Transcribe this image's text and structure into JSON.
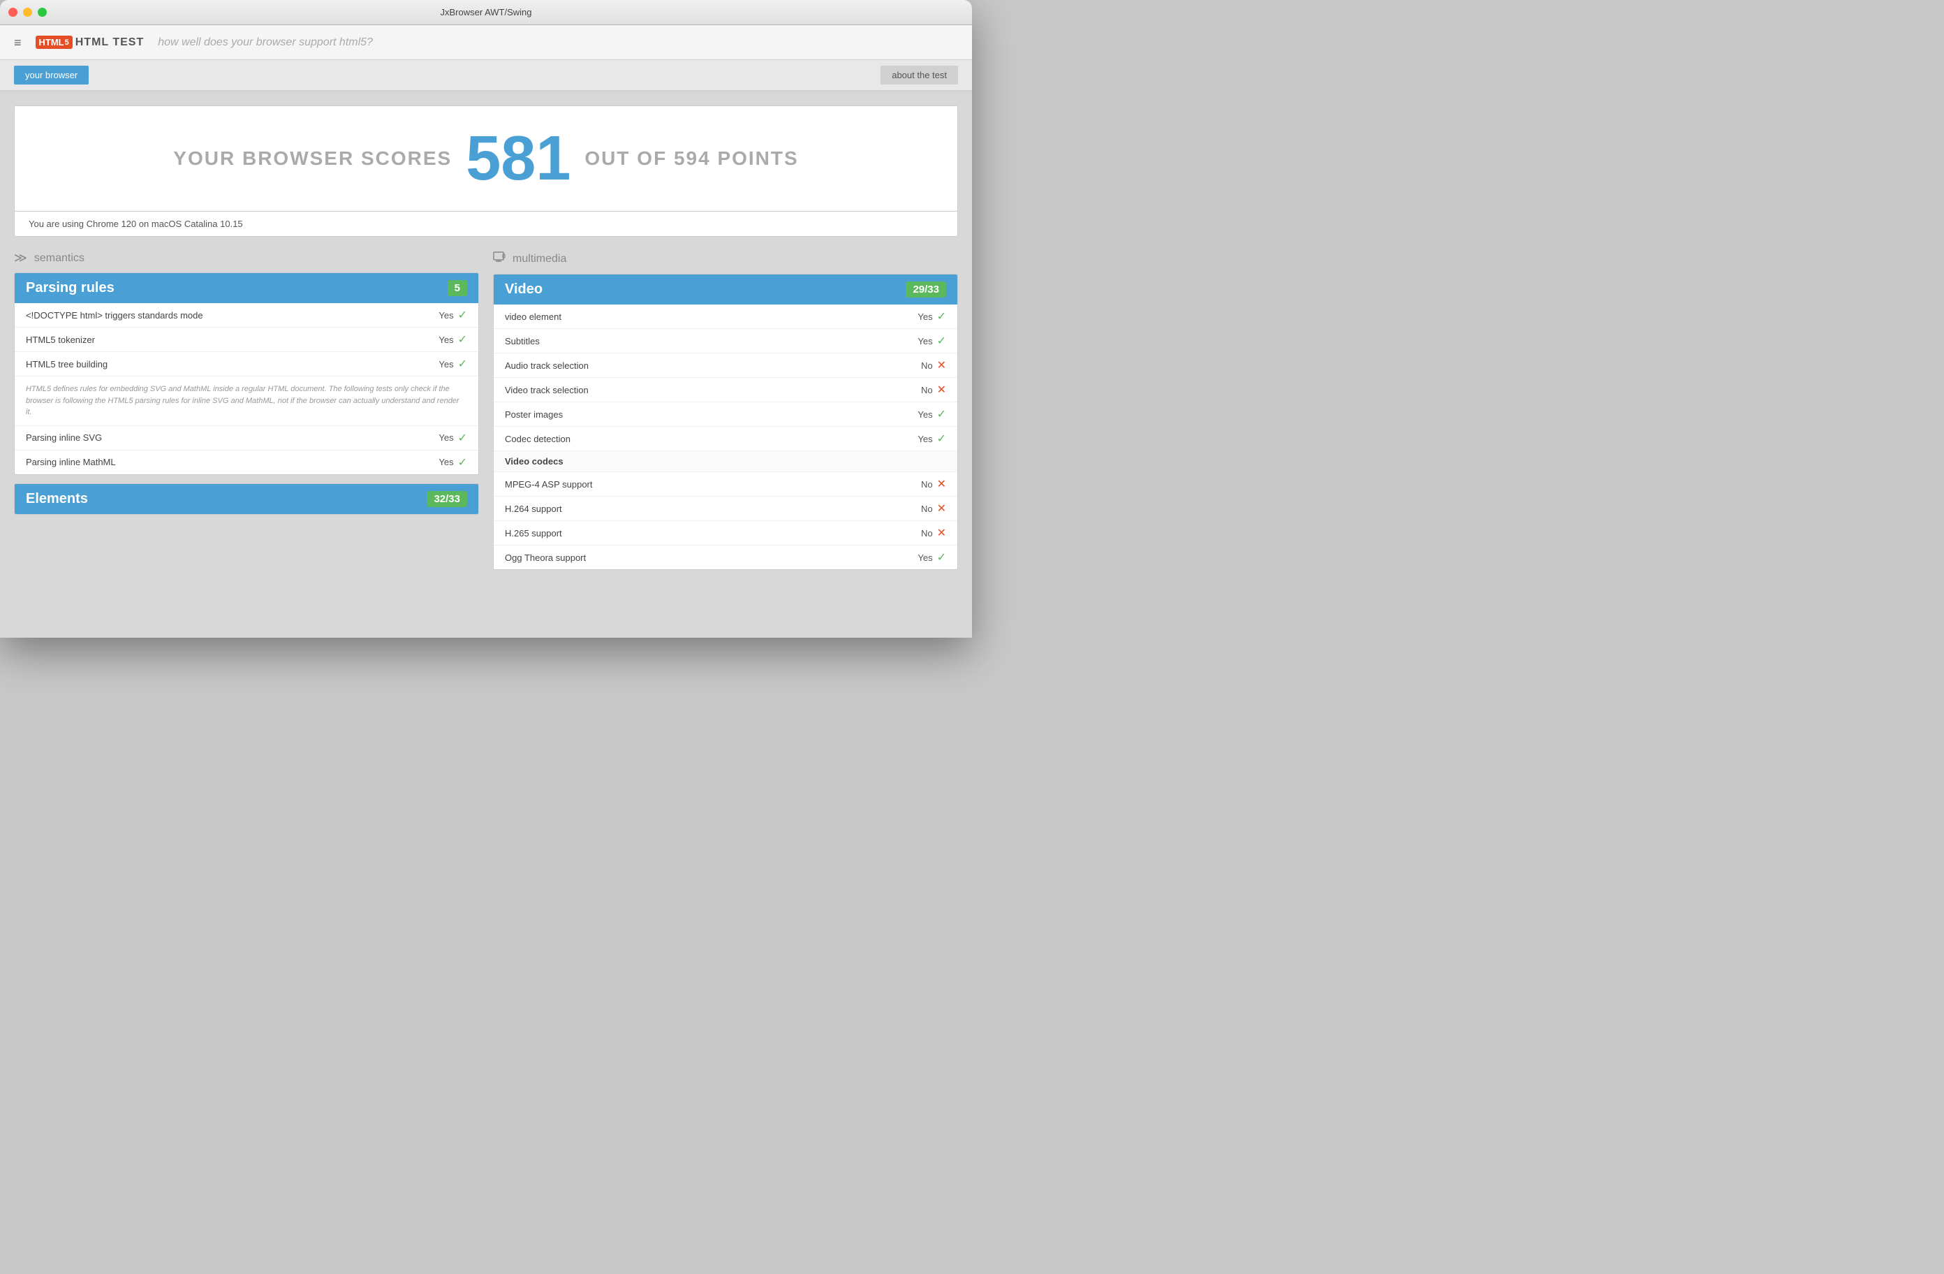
{
  "titlebar": {
    "title": "JxBrowser AWT/Swing"
  },
  "navbar": {
    "hamburger": "≡",
    "brand": "HTML TEST",
    "brand_number": "5",
    "tagline": "how well does your browser support html5?"
  },
  "tabs": {
    "active": "your browser",
    "inactive": "about the test"
  },
  "score_banner": {
    "prefix": "YOUR BROWSER SCORES",
    "score": "581",
    "suffix": "OUT OF 594 POINTS"
  },
  "browser_info": "You are using Chrome 120 on macOS Catalina 10.15",
  "sections": [
    {
      "id": "semantics",
      "icon": "❖",
      "name": "semantics",
      "cards": [
        {
          "title": "Parsing rules",
          "score": "5",
          "rows": [
            {
              "label": "<!DOCTYPE html> triggers standards mode",
              "result": "Yes",
              "pass": true
            },
            {
              "label": "HTML5 tokenizer",
              "result": "Yes",
              "pass": true
            },
            {
              "label": "HTML5 tree building",
              "result": "Yes",
              "pass": true
            }
          ],
          "note": "HTML5 defines rules for embedding SVG and MathML inside a regular HTML document. The following tests only check if the browser is following the HTML5 parsing rules for inline SVG and MathML, not if the browser can actually understand and render it.",
          "rows2": [
            {
              "label": "Parsing inline SVG",
              "result": "Yes",
              "pass": true
            },
            {
              "label": "Parsing inline MathML",
              "result": "Yes",
              "pass": true
            }
          ]
        },
        {
          "title": "Elements",
          "score": "32/33",
          "rows": []
        }
      ]
    },
    {
      "id": "multimedia",
      "icon": "▶",
      "name": "multimedia",
      "cards": [
        {
          "title": "Video",
          "score": "29/33",
          "rows": [
            {
              "label": "video element",
              "result": "Yes",
              "pass": true
            },
            {
              "label": "Subtitles",
              "result": "Yes",
              "pass": true
            },
            {
              "label": "Audio track selection",
              "result": "No",
              "pass": false
            },
            {
              "label": "Video track selection",
              "result": "No",
              "pass": false
            },
            {
              "label": "Poster images",
              "result": "Yes",
              "pass": true
            },
            {
              "label": "Codec detection",
              "result": "Yes",
              "pass": true
            }
          ],
          "subsection": "Video codecs",
          "rows2": [
            {
              "label": "MPEG-4 ASP support",
              "result": "No",
              "pass": false
            },
            {
              "label": "H.264 support",
              "result": "No",
              "pass": false
            },
            {
              "label": "H.265 support",
              "result": "No",
              "pass": false
            },
            {
              "label": "Ogg Theora support",
              "result": "Yes",
              "pass": true
            }
          ]
        }
      ]
    }
  ]
}
